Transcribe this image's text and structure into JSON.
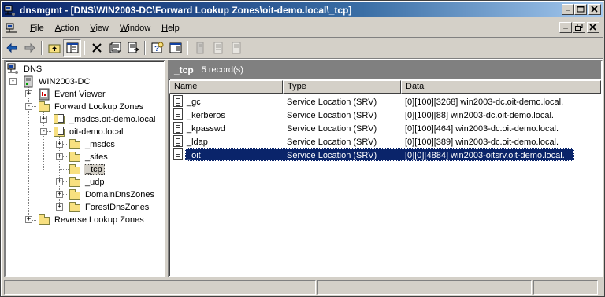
{
  "window": {
    "title": "dnsmgmt - [DNS\\WIN2003-DC\\Forward Lookup Zones\\oit-demo.local\\_tcp]",
    "minimize": "_",
    "maximize": "□",
    "close": "X"
  },
  "menu": {
    "items": [
      {
        "label": "File",
        "accel": "F",
        "rest": "ile"
      },
      {
        "label": "Action",
        "accel": "A",
        "rest": "ction"
      },
      {
        "label": "View",
        "accel": "V",
        "rest": "iew"
      },
      {
        "label": "Window",
        "accel": "W",
        "rest": "indow"
      },
      {
        "label": "Help",
        "accel": "H",
        "rest": "elp"
      }
    ]
  },
  "toolbar": {
    "buttons": [
      "back-icon",
      "forward-icon",
      "up-folder-icon",
      "show-hide-tree-icon",
      "delete-icon",
      "properties-icon",
      "export-list-icon",
      "help-icon",
      "console-tree-icon",
      "server-icon",
      "zone-icon",
      "record-icon"
    ]
  },
  "tree": {
    "nodes": [
      {
        "label": "DNS",
        "icon": "dns-icon"
      },
      {
        "label": "WIN2003-DC",
        "icon": "server-icon"
      },
      {
        "label": "Event Viewer",
        "icon": "event-viewer-icon"
      },
      {
        "label": "Forward Lookup Zones",
        "icon": "folder-icon"
      },
      {
        "label": "_msdcs.oit-demo.local",
        "icon": "zone-icon"
      },
      {
        "label": "oit-demo.local",
        "icon": "zone-icon"
      },
      {
        "label": "_msdcs",
        "icon": "folder-icon"
      },
      {
        "label": "_sites",
        "icon": "folder-icon"
      },
      {
        "label": "_tcp",
        "icon": "folder-icon"
      },
      {
        "label": "_udp",
        "icon": "folder-icon"
      },
      {
        "label": "DomainDnsZones",
        "icon": "folder-icon"
      },
      {
        "label": "ForestDnsZones",
        "icon": "folder-icon"
      },
      {
        "label": "Reverse Lookup Zones",
        "icon": "folder-icon"
      }
    ]
  },
  "list": {
    "title": "_tcp",
    "count": "5 record(s)",
    "columns": [
      "Name",
      "Type",
      "Data"
    ],
    "rows": [
      {
        "name": "_gc",
        "type": "Service Location (SRV)",
        "data": "[0][100][3268] win2003-dc.oit-demo.local."
      },
      {
        "name": "_kerberos",
        "type": "Service Location (SRV)",
        "data": "[0][100][88] win2003-dc.oit-demo.local."
      },
      {
        "name": "_kpasswd",
        "type": "Service Location (SRV)",
        "data": "[0][100][464] win2003-dc.oit-demo.local."
      },
      {
        "name": "_ldap",
        "type": "Service Location (SRV)",
        "data": "[0][100][389] win2003-dc.oit-demo.local."
      },
      {
        "name": "_oit",
        "type": "Service Location (SRV)",
        "data": "[0][0][4884] win2003-oitsrv.oit-demo.local."
      }
    ]
  },
  "colors": {
    "titlebar_start": "#0a246a",
    "selection": "#0a246a",
    "chrome": "#d4d0c8"
  }
}
